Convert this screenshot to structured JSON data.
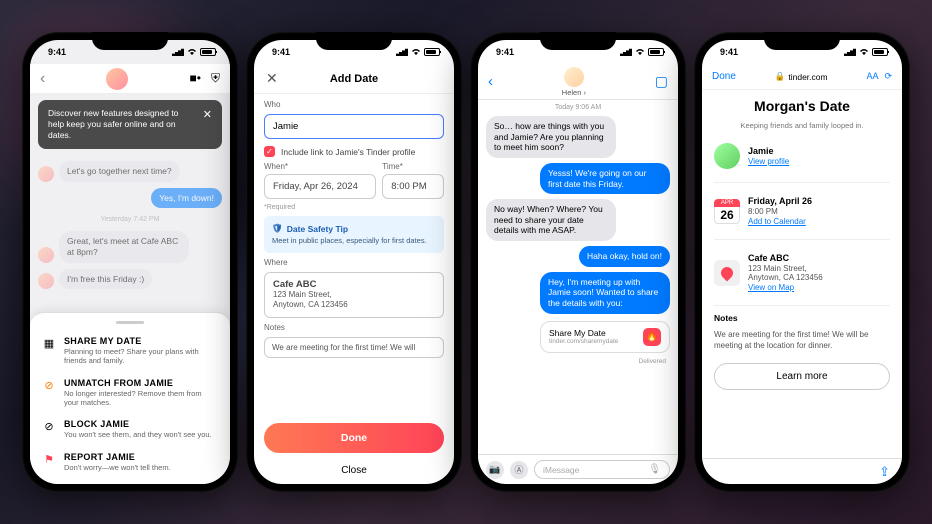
{
  "time": "9:41",
  "phone1": {
    "banner": "Discover new features designed to help keep you safer online and on dates.",
    "chat": {
      "m1": "Let's go together next time?",
      "m2": "Yes, I'm down!",
      "ts": "Yesterday 7:42 PM",
      "m3": "Great, let's meet at Cafe ABC at 8pm?",
      "m4": "I'm free this Friday :)"
    },
    "menu": {
      "share": {
        "title": "SHARE MY DATE",
        "sub": "Planning to meet? Share your plans with friends and family."
      },
      "unmatch": {
        "title": "UNMATCH FROM JAMIE",
        "sub": "No longer interested? Remove them from your matches."
      },
      "block": {
        "title": "BLOCK JAMIE",
        "sub": "You won't see them, and they won't see you."
      },
      "report": {
        "title": "REPORT JAMIE",
        "sub": "Don't worry—we won't tell them."
      }
    }
  },
  "phone2": {
    "title": "Add Date",
    "who_label": "Who",
    "who_value": "Jamie",
    "include_link": "Include link to Jamie's Tinder profile",
    "when_label": "When*",
    "time_label": "Time*",
    "when_value": "Friday, Apr 26, 2024",
    "time_value": "8:00 PM",
    "required": "*Required",
    "tip_title": "Date Safety Tip",
    "tip_text": "Meet in public places, especially for first dates.",
    "where_label": "Where",
    "where_name": "Cafe ABC",
    "where_l1": "123 Main Street,",
    "where_l2": "Anytown, CA 123456",
    "notes_label": "Notes",
    "notes_value": "We are meeting for the first time! We will",
    "done": "Done",
    "close": "Close"
  },
  "phone3": {
    "contact": "Helen",
    "ts": "Today 9:06 AM",
    "m1": "So… how are things with you and Jamie? Are you planning to meet him soon?",
    "m2": "Yesss! We're going on our first date this Friday.",
    "m3": "No way! When? Where? You need to share your date details with me ASAP.",
    "m4": "Haha okay, hold on!",
    "m5": "Hey, I'm meeting up with Jamie soon! Wanted to share the details with you:",
    "share_title": "Share My Date",
    "share_sub": "tinder.com/sharemydate",
    "delivered": "Delivered",
    "placeholder": "iMessage"
  },
  "phone4": {
    "done": "Done",
    "url": "tinder.com",
    "aa": "AA",
    "title": "Morgan's Date",
    "subtitle": "Keeping friends and family looped in.",
    "who": "Jamie",
    "view_profile": "View profile",
    "cal_month": "APR",
    "cal_day": "26",
    "date_line": "Friday, April 26",
    "time_line": "8:00 PM",
    "add_cal": "Add to Calendar",
    "where_name": "Cafe ABC",
    "where_l1": "123 Main Street,",
    "where_l2": "Anytown, CA 123456",
    "view_map": "View on Map",
    "notes_label": "Notes",
    "notes_text": "We are meeting for the first time! We will be meeting at the location for dinner.",
    "learn": "Learn more"
  }
}
